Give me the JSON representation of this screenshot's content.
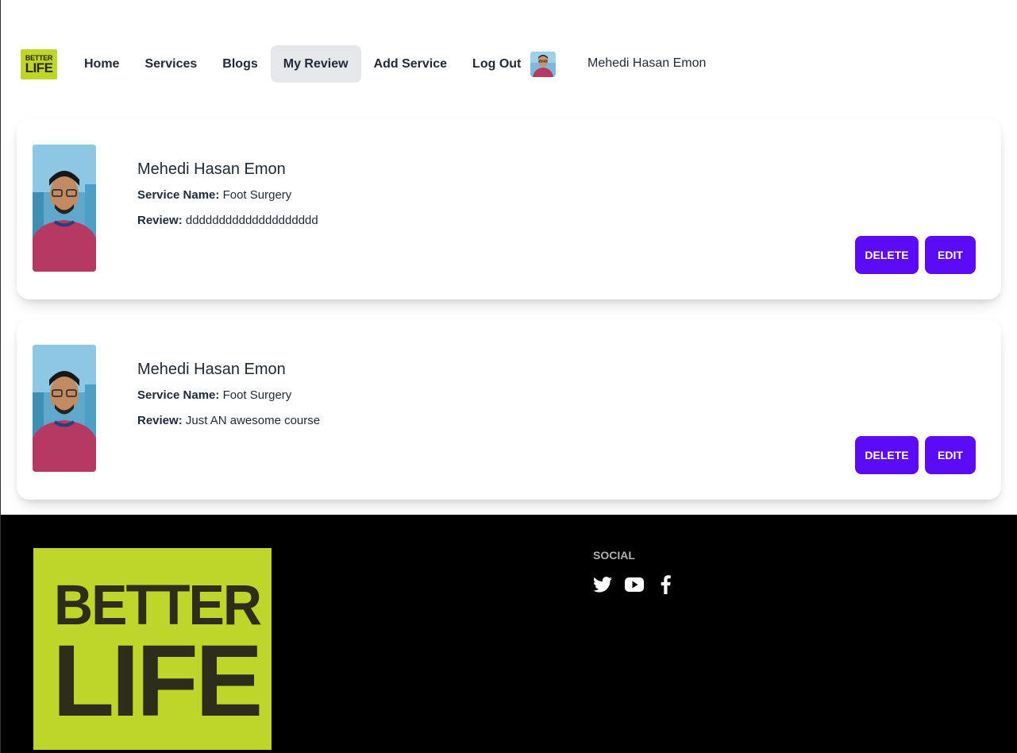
{
  "brand": {
    "logo_line1": "BETTER",
    "logo_line2": "LIFE",
    "accent_color": "#bed62a"
  },
  "navbar": {
    "items": [
      {
        "label": "Home",
        "active": false
      },
      {
        "label": "Services",
        "active": false
      },
      {
        "label": "Blogs",
        "active": false
      },
      {
        "label": "My Review",
        "active": true
      },
      {
        "label": "Add Service",
        "active": false
      },
      {
        "label": "Log Out",
        "active": false
      }
    ],
    "user_name": "Mehedi Hasan Emon",
    "avatar_icon": "user-avatar"
  },
  "reviews": [
    {
      "name": "Mehedi Hasan Emon",
      "service_label": "Service Name:",
      "service_name": "Foot Surgery",
      "review_label": "Review:",
      "review_text": "dddddddddddddddddddd",
      "delete_label": "DELETE",
      "edit_label": "EDIT"
    },
    {
      "name": "Mehedi Hasan Emon",
      "service_label": "Service Name:",
      "service_name": "Foot Surgery",
      "review_label": "Review:",
      "review_text": "Just AN awesome course",
      "delete_label": "DELETE",
      "edit_label": "EDIT"
    }
  ],
  "colors": {
    "button": "#5b0cf5",
    "active_nav": "#e5e7eb",
    "footer_bg": "#000000"
  },
  "footer": {
    "logo_line1": "BETTER",
    "logo_line2": "LIFE",
    "social_title": "SOCIAL",
    "social_icons": [
      "twitter-icon",
      "youtube-icon",
      "facebook-icon"
    ]
  }
}
